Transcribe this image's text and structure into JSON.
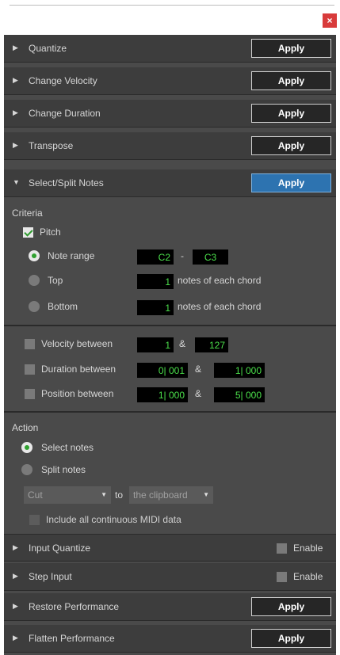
{
  "window": {
    "close_glyph": "×"
  },
  "sections_top": [
    {
      "label": "Quantize",
      "button": "Apply"
    },
    {
      "label": "Change Velocity",
      "button": "Apply"
    },
    {
      "label": "Change Duration",
      "button": "Apply"
    },
    {
      "label": "Transpose",
      "button": "Apply"
    }
  ],
  "select_split": {
    "label": "Select/Split Notes",
    "button": "Apply",
    "criteria_label": "Criteria",
    "pitch": {
      "label": "Pitch",
      "checked": true
    },
    "note_range": {
      "label": "Note range",
      "selected": true,
      "from": "C2",
      "sep": "-",
      "to": "C3"
    },
    "top": {
      "label": "Top",
      "value": "1",
      "suffix": "notes of each chord"
    },
    "bottom": {
      "label": "Bottom",
      "value": "1",
      "suffix": "notes of each chord"
    },
    "velocity": {
      "label": "Velocity between",
      "from": "1",
      "and": "&",
      "to": "127"
    },
    "duration": {
      "label": "Duration between",
      "from": "0| 001",
      "and": "&",
      "to": "1| 000"
    },
    "position": {
      "label": "Position between",
      "from": "1| 000",
      "and": "&",
      "to": "5| 000"
    },
    "action_label": "Action",
    "select_notes": {
      "label": "Select notes",
      "selected": true
    },
    "split_notes": {
      "label": "Split notes",
      "selected": false
    },
    "cut_select": "Cut",
    "to_label": "to",
    "dest_select": "the clipboard",
    "include_midi": "Include all continuous MIDI data"
  },
  "sections_bottom": [
    {
      "label": "Input Quantize",
      "enable": "Enable"
    },
    {
      "label": "Step Input",
      "enable": "Enable"
    },
    {
      "label": "Restore Performance",
      "button": "Apply"
    },
    {
      "label": "Flatten Performance",
      "button": "Apply"
    }
  ],
  "colors": {
    "panel": "#4a4a4a",
    "header": "#3d3d3d",
    "accent_blue": "#2d73b0",
    "value_green": "#4be04b",
    "close_red": "#d83b3b"
  }
}
